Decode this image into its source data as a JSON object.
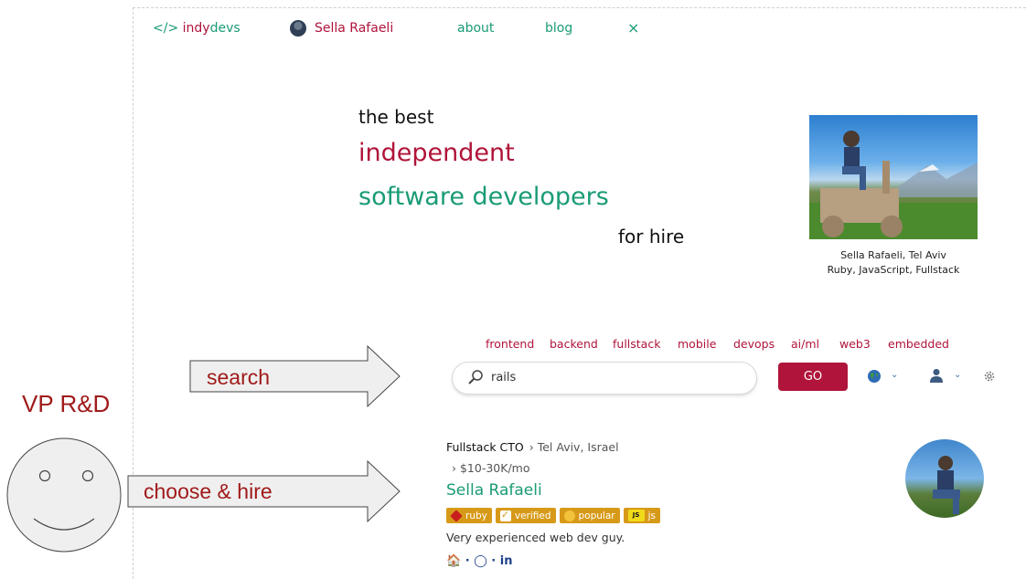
{
  "nav": {
    "logo_prefix": "</> ",
    "logo_indy": "indy",
    "logo_devs": "devs",
    "user_name": "Sella Rafaeli",
    "about": "about",
    "blog": "blog",
    "close": "×"
  },
  "hero": {
    "line1": "the best",
    "line2": "independent",
    "line3": "software developers",
    "line4": "for hire"
  },
  "featured": {
    "caption_line1": "Sella Rafaeli, Tel Aviv",
    "caption_line2": "Ruby, JavaScript, Fullstack"
  },
  "categories": [
    "frontend",
    "backend",
    "fullstack",
    "mobile",
    "devops",
    "ai/ml",
    "web3",
    "embedded"
  ],
  "search": {
    "value": "rails",
    "go_label": "GO"
  },
  "result": {
    "role": "Fullstack CTO",
    "location": "› Tel Aviv, Israel",
    "rate": "› $10-30K/mo",
    "name": "Sella Rafaeli",
    "badges": [
      "ruby",
      "verified",
      "popular",
      "js"
    ],
    "description": "Very experienced web dev guy.",
    "links": "🏠 · ◯ · in"
  },
  "annotations": {
    "persona": "VP R&D",
    "arrow1_label": "search",
    "arrow2_label": "choose & hire"
  },
  "colors": {
    "brand_red": "#b0143a",
    "brand_green": "#1a9b76",
    "badge_gold": "#d79a18",
    "annotation_red": "#a01a1a"
  }
}
